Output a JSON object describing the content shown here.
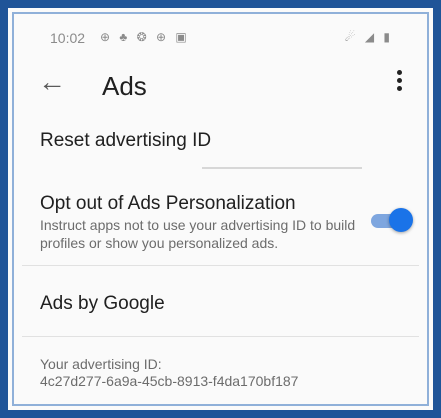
{
  "status_bar": {
    "time": "10:02",
    "notification_icons": "⊕ ♣ ❂ ⊕ ▣",
    "system_icons": "☄ ◢ ▮"
  },
  "app_bar": {
    "back_icon": "arrow-back-icon",
    "title": "Ads",
    "menu_icon": "more-vert-icon"
  },
  "settings": {
    "reset": {
      "label": "Reset advertising ID"
    },
    "opt_out": {
      "label": "Opt out of Ads Personalization",
      "description": "Instruct apps not to use your advertising ID to build profiles or show you personalized ads.",
      "enabled": true,
      "accent": "#1a73e8"
    },
    "ads_by_google": {
      "label": "Ads by Google"
    },
    "advertising_id": {
      "label": "Your advertising ID:",
      "value": "4c27d277-6a9a-45cb-8913-f4da170bf187"
    }
  }
}
